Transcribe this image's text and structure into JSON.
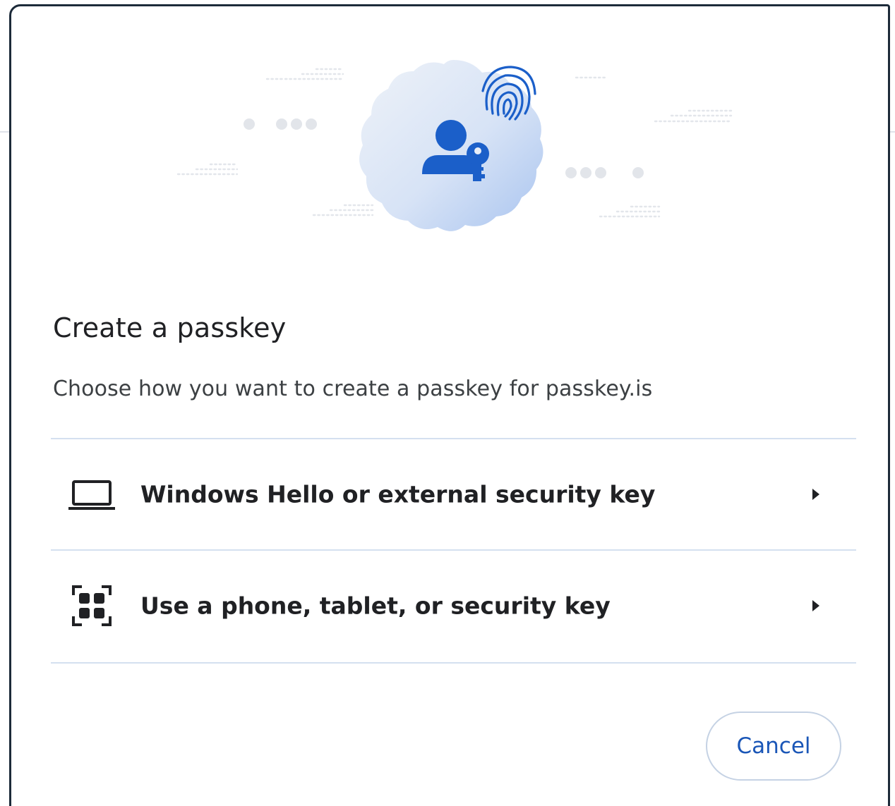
{
  "dialog": {
    "title": "Create a passkey",
    "subtitle": "Choose how you want to create a passkey for passkey.is",
    "options": [
      {
        "label": "Windows Hello or external security key",
        "icon": "laptop-icon",
        "chevron": "chevron-right-icon"
      },
      {
        "label": "Use a phone, tablet, or security key",
        "icon": "qr-code-icon",
        "chevron": "chevron-right-icon"
      }
    ],
    "cancel_label": "Cancel"
  },
  "hero": {
    "icons": [
      "badge-icon",
      "person-key-icon",
      "fingerprint-icon"
    ]
  },
  "colors": {
    "accent": "#1a56b7",
    "icon_blue": "#1b5fc9",
    "border": "#1d2b3a",
    "divider": "#d4e0f0",
    "text": "#202124"
  }
}
